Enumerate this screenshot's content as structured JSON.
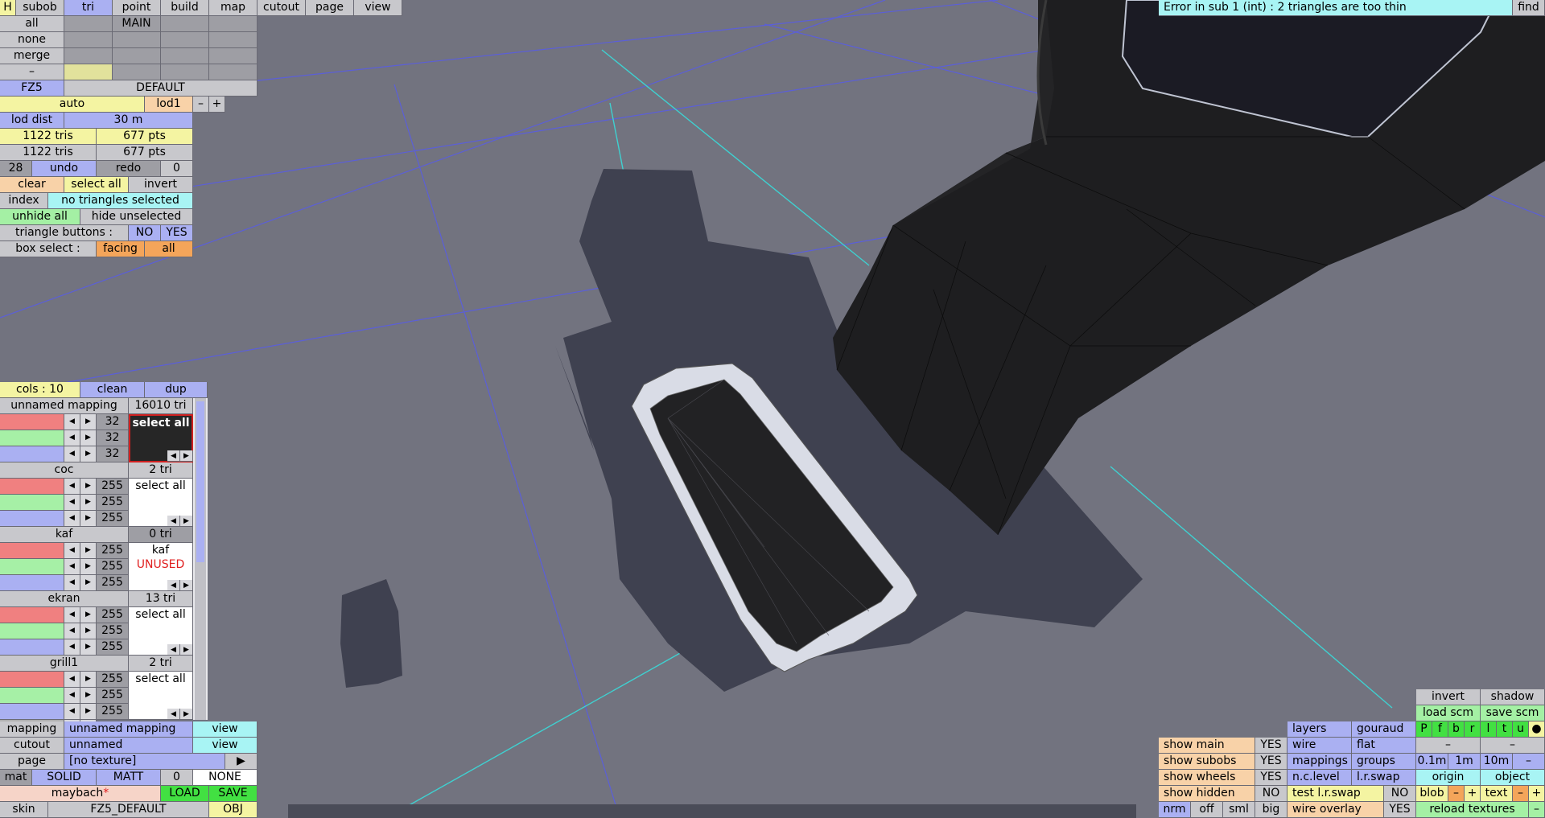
{
  "top_menu": {
    "h": "H",
    "subob": "subob",
    "tri": "tri",
    "point": "point",
    "build": "build",
    "map": "map",
    "cutout": "cutout",
    "page": "page",
    "view": "view"
  },
  "sel_panel": {
    "all": "all",
    "none": "none",
    "merge": "merge",
    "minus": "–",
    "main": "MAIN",
    "fz5": "FZ5",
    "default": "DEFAULT"
  },
  "lod": {
    "auto": "auto",
    "lod1": "lod1",
    "minus": "–",
    "plus": "+",
    "lod_dist_label": "lod dist",
    "lod_dist_value": "30 m",
    "tris1": "1122 tris",
    "pts1": "677 pts",
    "tris2": "1122 tris",
    "pts2": "677 pts"
  },
  "history": {
    "count": "28",
    "undo": "undo",
    "redo": "redo",
    "redo_count": "0"
  },
  "select": {
    "clear": "clear",
    "select_all": "select all",
    "invert": "invert",
    "index": "index",
    "status": "no triangles selected",
    "unhide_all": "unhide all",
    "hide_unselected": "hide unselected",
    "tri_buttons_label": "triangle buttons :",
    "no": "NO",
    "yes": "YES",
    "box_select_label": "box select :",
    "facing": "facing",
    "all": "all"
  },
  "error": {
    "message": "Error in sub 1 (int) : 2 triangles are too thin",
    "find": "find"
  },
  "materials": {
    "cols": "cols : 10",
    "clean": "clean",
    "dup": "dup",
    "mapping_name": "unnamed mapping",
    "mapping_tri": "16010 tri",
    "first_values": [
      "32",
      "32",
      "32"
    ],
    "first_select": "select all",
    "items": [
      {
        "name": "coc",
        "tri": "2 tri",
        "values": [
          "255",
          "255",
          "255"
        ],
        "label": "select all",
        "sub": ""
      },
      {
        "name": "kaf",
        "tri": "0 tri",
        "values": [
          "255",
          "255",
          "255"
        ],
        "label": "kaf",
        "sub": "UNUSED"
      },
      {
        "name": "ekran",
        "tri": "13 tri",
        "values": [
          "255",
          "255",
          "255"
        ],
        "label": "select all",
        "sub": ""
      },
      {
        "name": "grill1",
        "tri": "2 tri",
        "values": [
          "255",
          "255",
          "255"
        ],
        "label": "select all",
        "sub": ""
      }
    ]
  },
  "bottom_left": {
    "mapping_label": "mapping",
    "mapping_value": "unnamed mapping",
    "view1": "view",
    "cutout_label": "cutout",
    "cutout_value": "unnamed",
    "view2": "view",
    "page_label": "page",
    "page_value": "[no texture]",
    "play": "▶",
    "mat": "mat",
    "solid": "SOLID",
    "matt": "MATT",
    "zero": "0",
    "none": "NONE",
    "maybach": "maybach",
    "maybach_star": "*",
    "load": "LOAD",
    "save": "SAVE",
    "skin": "skin",
    "skin_value": "FZ5_DEFAULT",
    "obj": "OBJ"
  },
  "bottom_right": {
    "invert": "invert",
    "shadow": "shadow",
    "load_scm": "load scm",
    "save_scm": "save scm",
    "layers": "layers",
    "gouraud": "gouraud",
    "wire": "wire",
    "flat": "flat",
    "layer_letters": [
      "P",
      "f",
      "b",
      "r",
      "l",
      "t",
      "u",
      "●"
    ],
    "mappings": "mappings",
    "groups": "groups",
    "nclevel": "n.c.level",
    "lrswap": "l.r.swap",
    "show_main": "show main",
    "show_subobs": "show subobs",
    "show_wheels": "show wheels",
    "show_hidden": "show hidden",
    "yes1": "YES",
    "yes2": "YES",
    "yes3": "YES",
    "no1": "NO",
    "dash1": "–",
    "dash2": "–",
    "s01": "0.1m",
    "s1": "1m",
    "s10": "10m",
    "dash3": "–",
    "origin": "origin",
    "object": "object",
    "test_lr": "test l.r.swap",
    "no2": "NO",
    "blob": "blob",
    "text": "text",
    "minus": "–",
    "plus": "+",
    "nrm": "nrm",
    "off": "off",
    "sml": "sml",
    "big": "big",
    "wire_overlay": "wire overlay",
    "yes4": "YES",
    "reload": "reload textures"
  }
}
